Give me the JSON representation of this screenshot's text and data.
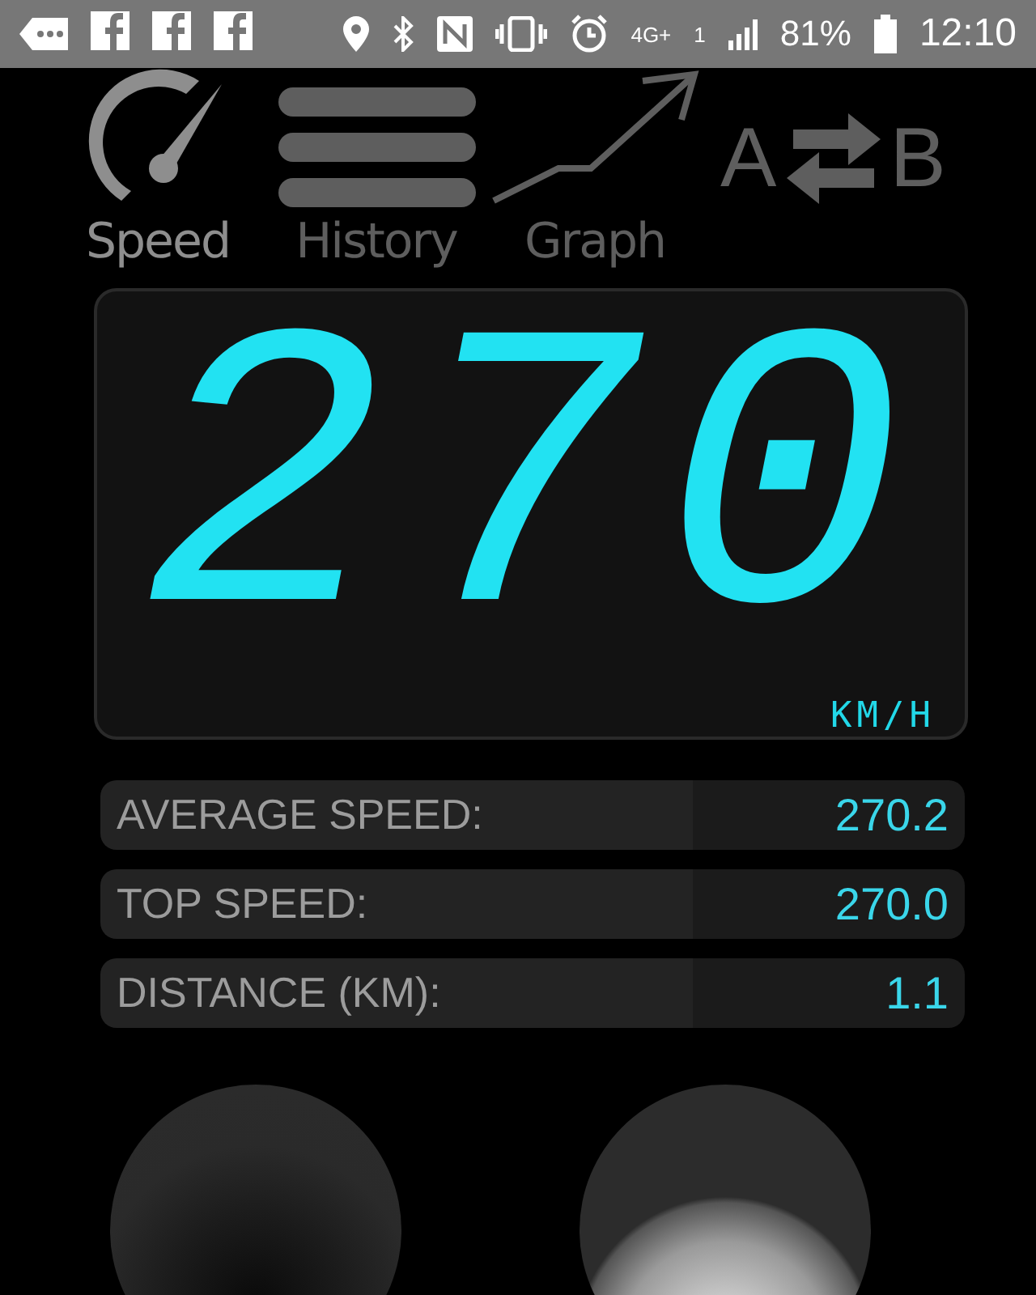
{
  "status_bar": {
    "network": "4G+",
    "signal_slot": "1",
    "battery": "81%",
    "time": "12:10"
  },
  "tabs": [
    {
      "label": "Speed",
      "kind": "speed",
      "selected": true
    },
    {
      "label": "History",
      "kind": "history",
      "selected": false
    },
    {
      "label": "Graph",
      "kind": "graph",
      "selected": false
    },
    {
      "kind": "swap",
      "left": "A",
      "right": "B",
      "selected": false
    }
  ],
  "display": {
    "reading": "270",
    "unit": "KM/H"
  },
  "stats": [
    {
      "label": "AVERAGE SPEED:",
      "value": "270.2"
    },
    {
      "label": "TOP SPEED:",
      "value": "270.0"
    },
    {
      "label": "DISTANCE (KM):",
      "value": "1.1"
    }
  ],
  "buttons": [
    {
      "lit": false
    },
    {
      "lit": true
    }
  ]
}
